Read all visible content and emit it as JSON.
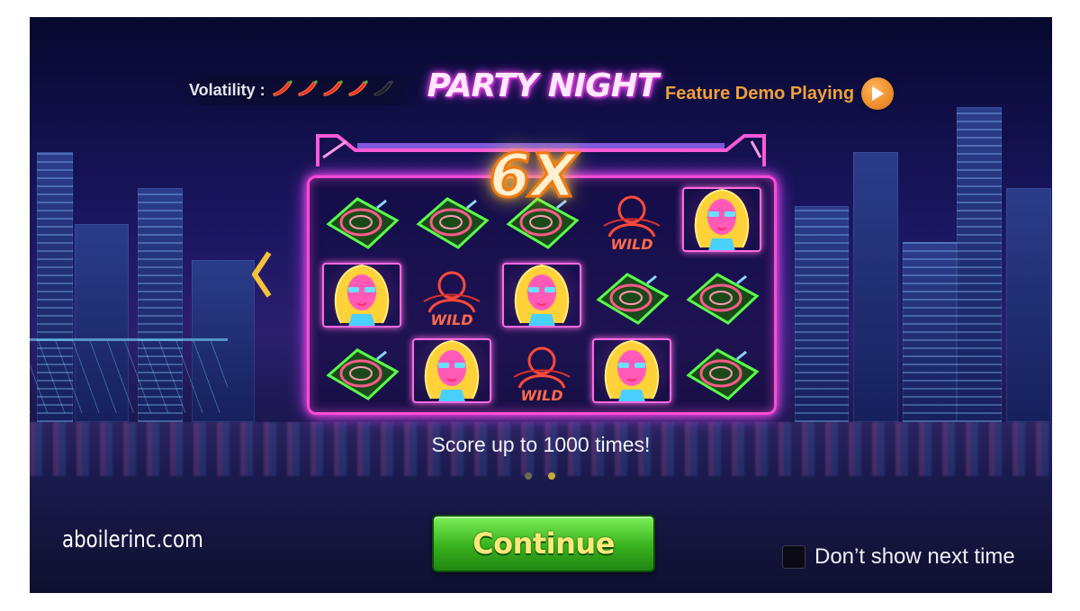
{
  "header": {
    "volatility_label": "Volatility :",
    "volatility_level": 4,
    "volatility_max": 5,
    "game_title": "PARTY NIGHT",
    "feature_label": "Feature Demo Playing"
  },
  "reels": {
    "multiplier": "6X",
    "wild_text": "WILD",
    "rows": [
      [
        "turntable",
        "turntable",
        "turntable",
        "wild",
        "girl"
      ],
      [
        "girl",
        "wild",
        "girl",
        "turntable",
        "turntable"
      ],
      [
        "turntable",
        "girl",
        "wild",
        "girl",
        "turntable"
      ]
    ]
  },
  "caption": "Score up to 1000 times!",
  "pagination": {
    "total": 2,
    "active": 2
  },
  "watermark": "aboilerinc.com",
  "continue_label": "Continue",
  "dont_show_label": "Don’t show next time",
  "colors": {
    "neon_pink": "#ff4bd6",
    "feature_orange": "#f0a03a",
    "button_green": "#38b21e",
    "button_text": "#ffe87a"
  }
}
